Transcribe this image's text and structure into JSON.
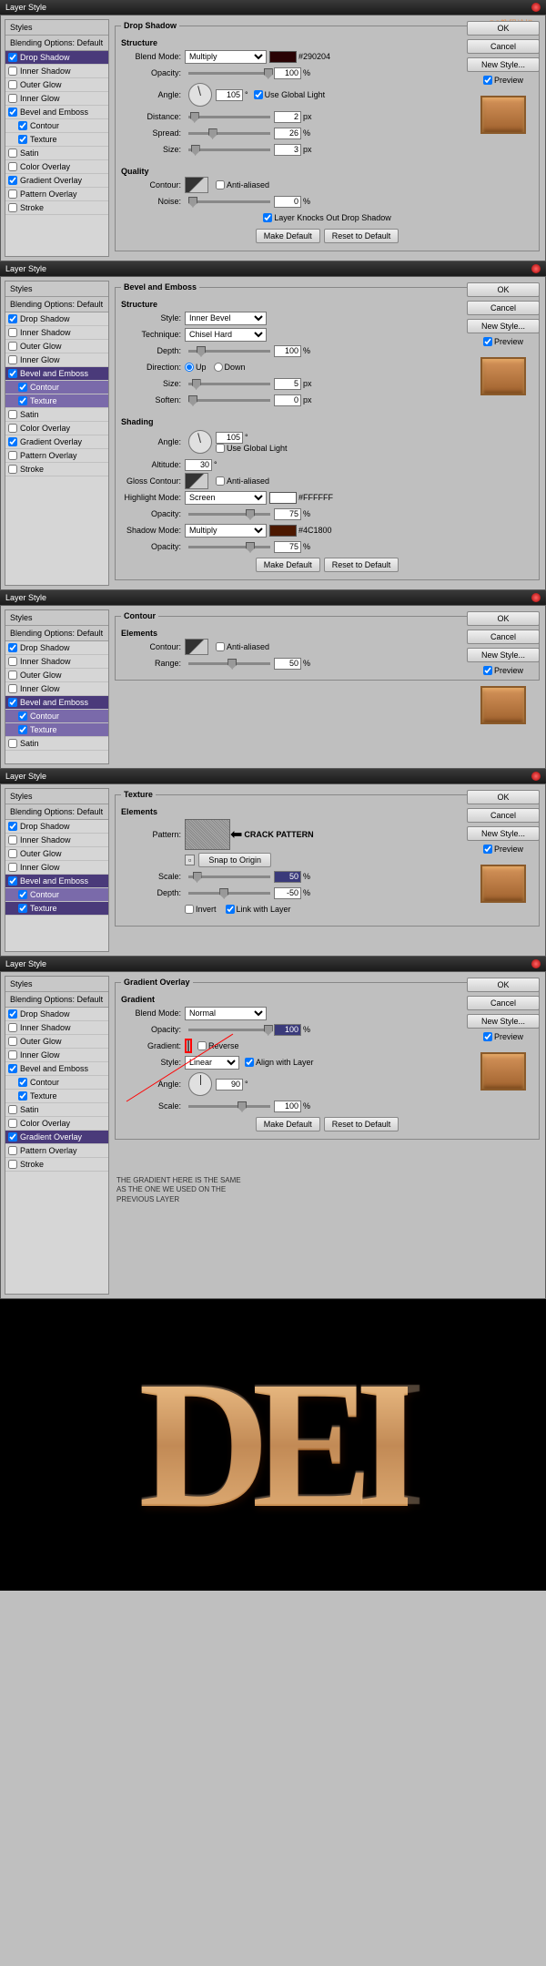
{
  "watermark": "PS教程论坛",
  "watermark2": "BBS.16XX8.COM",
  "titlebar": "Layer Style",
  "sidebar": {
    "styles": "Styles",
    "blending": "Blending Options: Default",
    "drop": "Drop Shadow",
    "innersh": "Inner Shadow",
    "outglow": "Outer Glow",
    "inglow": "Inner Glow",
    "bevel": "Bevel and Emboss",
    "contour": "Contour",
    "texture": "Texture",
    "satin": "Satin",
    "colorov": "Color Overlay",
    "gradov": "Gradient Overlay",
    "pattov": "Pattern Overlay",
    "stroke": "Stroke"
  },
  "btns": {
    "ok": "OK",
    "cancel": "Cancel",
    "newstyle": "New Style...",
    "preview": "Preview",
    "makedef": "Make Default",
    "resetdef": "Reset to Default",
    "snap": "Snap to Origin"
  },
  "labels": {
    "blendmode": "Blend Mode:",
    "opacity": "Opacity:",
    "angle": "Angle:",
    "distance": "Distance:",
    "spread": "Spread:",
    "size": "Size:",
    "contour": "Contour:",
    "noise": "Noise:",
    "style": "Style:",
    "technique": "Technique:",
    "depth": "Depth:",
    "direction": "Direction:",
    "soften": "Soften:",
    "altitude": "Altitude:",
    "glosscontour": "Gloss Contour:",
    "highlightmode": "Highlight Mode:",
    "shadowmode": "Shadow Mode:",
    "range": "Range:",
    "pattern": "Pattern:",
    "scale": "Scale:",
    "gradient": "Gradient:",
    "up": "Up",
    "down": "Down"
  },
  "ck": {
    "globallight": "Use Global Light",
    "antialias": "Anti-aliased",
    "knockout": "Layer Knocks Out Drop Shadow",
    "invert": "Invert",
    "linklayer": "Link with Layer",
    "reverse": "Reverse",
    "alignlayer": "Align with Layer"
  },
  "heads": {
    "dropshadow": "Drop Shadow",
    "structure": "Structure",
    "quality": "Quality",
    "bevelemboss": "Bevel and Emboss",
    "shading": "Shading",
    "contour": "Contour",
    "elements": "Elements",
    "texture": "Texture",
    "gradov": "Gradient Overlay",
    "gradient": "Gradient"
  },
  "d1": {
    "mode": "Multiply",
    "color": "#290204",
    "opacity": "100",
    "angle": "105",
    "distance": "2",
    "spread": "26",
    "size": "3",
    "noise": "0"
  },
  "d2": {
    "style": "Inner Bevel",
    "technique": "Chisel Hard",
    "depth": "100",
    "size": "5",
    "soften": "0",
    "sh_angle": "105",
    "sh_altitude": "30",
    "hlmode": "Screen",
    "hlcolor": "#FFFFFF",
    "hlopacity": "75",
    "shmode": "Multiply",
    "shcolor": "#4C1800",
    "shopacity": "75"
  },
  "d3": {
    "range": "50"
  },
  "d4": {
    "scale": "50",
    "depth": "-50",
    "crack": "CRACK PATTERN"
  },
  "d5": {
    "mode": "Normal",
    "opacity": "100",
    "style": "Linear",
    "angle": "90",
    "scale": "100",
    "note": "THE GRADIENT HERE IS THE SAME AS THE ONE WE USED ON THE PREVIOUS LAYER"
  },
  "result": "DEI"
}
